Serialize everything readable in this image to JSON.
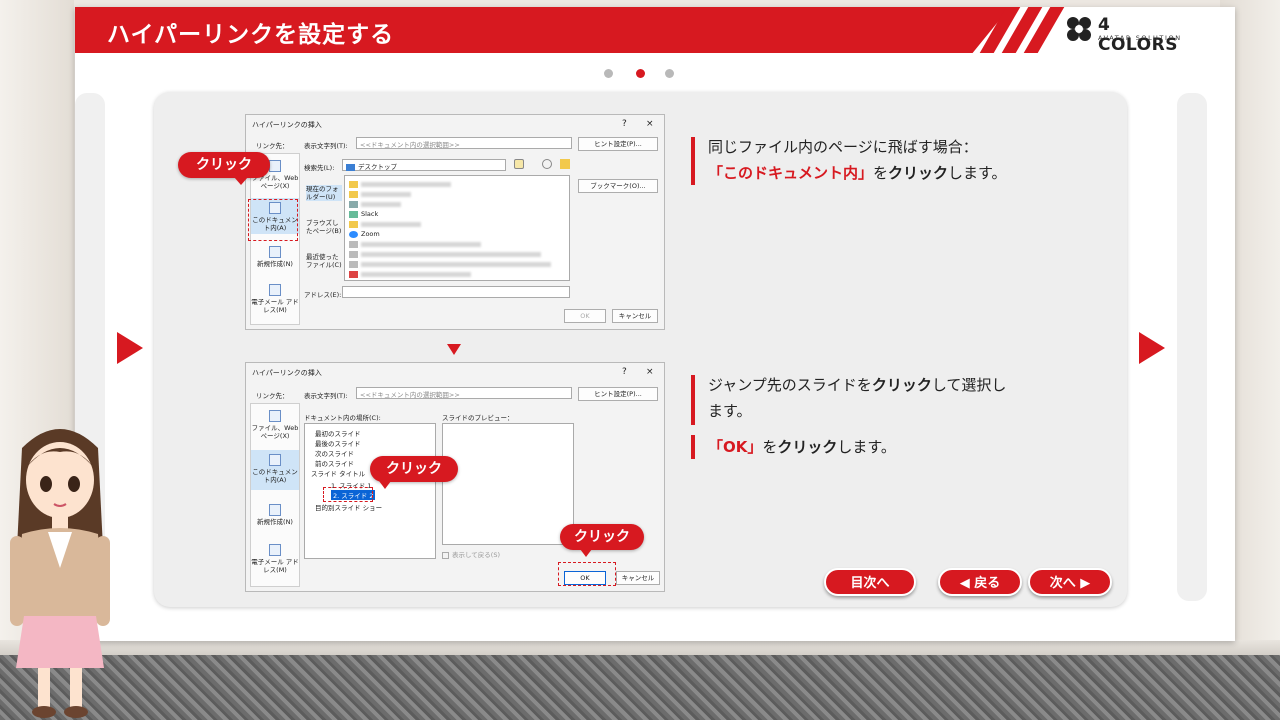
{
  "header": {
    "title": "ハイパーリンクを設定する",
    "logo_text": "4 COLORS",
    "logo_sub": "AVATAR SOLUTION"
  },
  "pager": {
    "current": 2,
    "total": 3
  },
  "dialog1": {
    "title": "ハイパーリンクの挿入",
    "help": "?",
    "close": "×",
    "link_to_label": "リンク先：",
    "display_text_label": "表示文字列(T):",
    "display_text_value": "<<ドキュメント内の選択範囲>>",
    "hint_button": "ヒント設定(P)...",
    "search_label": "検索先(L):",
    "search_value": "デスクトップ",
    "bookmark_button": "ブックマーク(O)...",
    "nav_items": [
      "ファイル、Web ページ(X)",
      "このドキュメント内(A)",
      "新規作成(N)",
      "電子メール アドレス(M)"
    ],
    "scope_items": [
      "現在のフォルダー(U)",
      "ブラウズしたページ(B)",
      "最近使ったファイル(C)"
    ],
    "file_items": [
      "Slack",
      "Zoom"
    ],
    "address_label": "アドレス(E):",
    "ok": "OK",
    "cancel": "キャンセル"
  },
  "dialog2": {
    "title": "ハイパーリンクの挿入",
    "help": "?",
    "close": "×",
    "link_to_label": "リンク先：",
    "display_text_label": "表示文字列(T):",
    "display_text_value": "<<ドキュメント内の選択範囲>>",
    "hint_button": "ヒント設定(P)...",
    "doc_place_label": "ドキュメント内の場所(C):",
    "preview_label": "スライドのプレビュー：",
    "nav_items": [
      "ファイル、Web ページ(X)",
      "このドキュメント内(A)",
      "新規作成(N)",
      "電子メール アドレス(M)"
    ],
    "tree": [
      "最初のスライド",
      "最後のスライド",
      "次のスライド",
      "前のスライド",
      "スライド タイトル",
      "1. スライド 1",
      "2. スライド 2",
      "目的別スライド ショー"
    ],
    "show_return": "表示して戻る(S)",
    "ok": "OK",
    "cancel": "キャンセル"
  },
  "callouts": {
    "click": "クリック"
  },
  "instructions": {
    "step1_line1": "同じファイル内のページに飛ばす場合：",
    "step1_highlight": "「このドキュメント内」",
    "step1_wo": "を",
    "step1_click": "クリック",
    "step1_tail": "します。",
    "step2_line1a": "ジャンプ先のスライドを",
    "step2_click": "クリック",
    "step2_line1b": "して選択し",
    "step2_line2": "ます。",
    "step3_highlight": "「OK」",
    "step3_wo": "を",
    "step3_click": "クリック",
    "step3_tail": "します。"
  },
  "nav": {
    "toc": "目次へ",
    "back": "◀ 戻る",
    "next": "次へ ▶"
  },
  "colors": {
    "accent": "#d71920",
    "card": "#eeeeee",
    "board": "#ffffff"
  },
  "icons": [
    "prev-arrow-icon",
    "next-arrow-icon",
    "logo-icon",
    "folder-icon"
  ]
}
